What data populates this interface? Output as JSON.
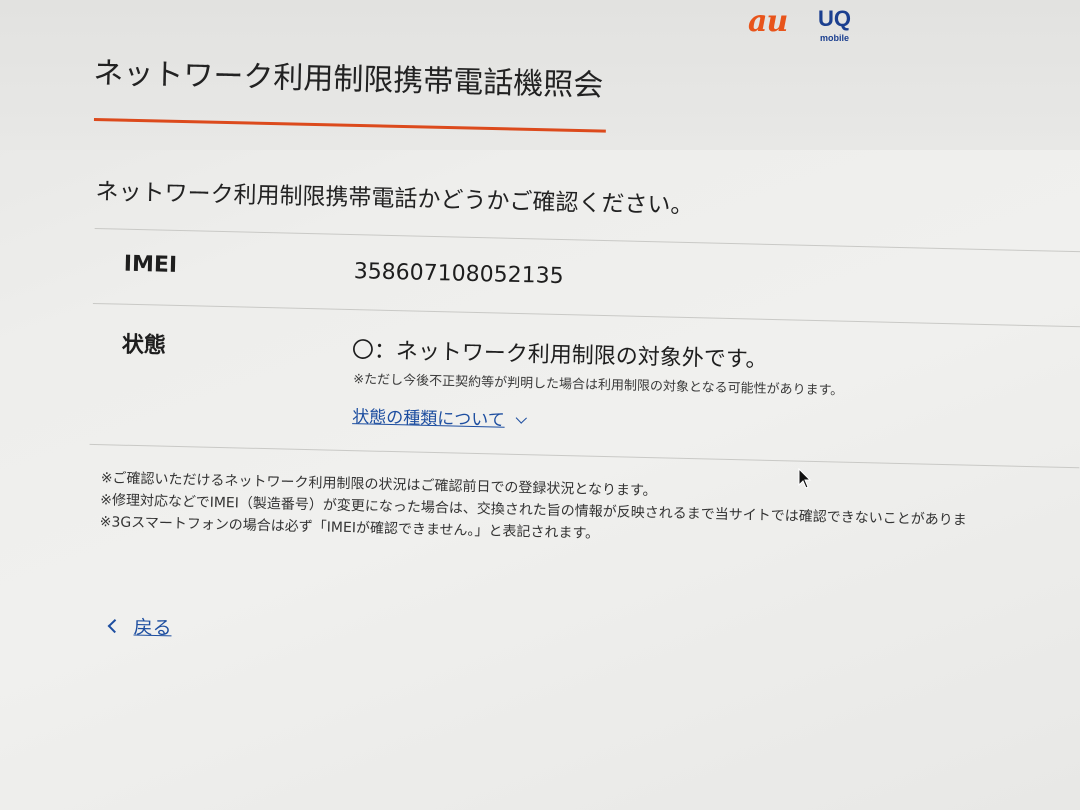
{
  "header": {
    "logo_au": "au",
    "logo_uq": "UQ",
    "logo_uq_sub": "mobile",
    "title": "ネットワーク利用制限携帯電話機照会"
  },
  "main": {
    "intro": "ネットワーク利用制限携帯電話かどうかご確認ください。",
    "rows": [
      {
        "label": "IMEI",
        "value": "358607108052135"
      },
      {
        "label": "状態",
        "value": "〇：ネットワーク利用制限の対象外です。",
        "note": "※ただし今後不正契約等が判明した場合は利用制限の対象となる可能性があります。",
        "link": "状態の種類について"
      }
    ],
    "notes": [
      "※ご確認いただけるネットワーク利用制限の状況はご確認前日での登録状況となります。",
      "※修理対応などでIMEI（製造番号）が変更になった場合は、交換された旨の情報が反映されるまで当サイトでは確認できないことがありま",
      "※3Gスマートフォンの場合は必ず「IMEIが確認できません。」と表記されます。"
    ]
  },
  "footer": {
    "back_label": "戻る"
  },
  "colors": {
    "accent": "#dc4a1c",
    "link": "#1d4ea0",
    "au_brand": "#e8541b",
    "uq_brand": "#1b3f8f"
  },
  "icons": {
    "expand": "chevron-down-icon",
    "back": "chevron-left-icon",
    "pointer": "mouse-cursor-icon"
  }
}
